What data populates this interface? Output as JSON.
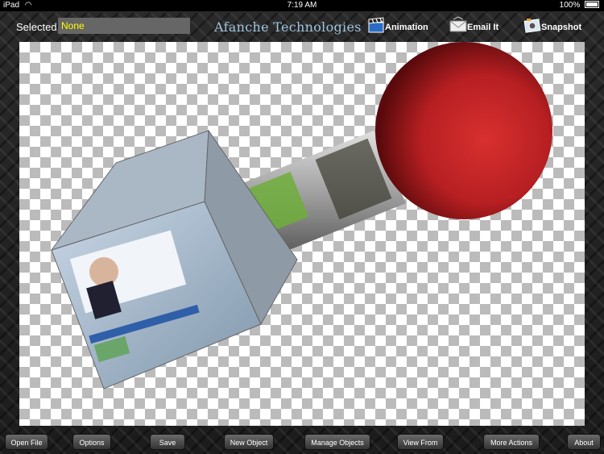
{
  "status_bar": {
    "device": "iPad",
    "time": "7:19 AM",
    "battery": "100%"
  },
  "toolbar": {
    "selected_label": "Selected",
    "selected_value": "None",
    "app_title": "Afanche Technologies",
    "animation_label": "Animation",
    "email_label": "Email It",
    "snapshot_label": "Snapshot"
  },
  "bottom_bar": {
    "buttons": [
      "Open File",
      "Options",
      "Save",
      "New Object",
      "Manage Objects",
      "View From",
      "More Actions",
      "About"
    ]
  },
  "scene": {
    "objects": [
      "textured-cube",
      "textured-cylinder",
      "red-sphere"
    ],
    "sphere_color": "#c0262a",
    "checker_color": "#bbbbbb"
  },
  "icons": [
    "wifi-icon",
    "battery-icon",
    "clapperboard-icon",
    "envelope-icon",
    "camera-icon"
  ]
}
